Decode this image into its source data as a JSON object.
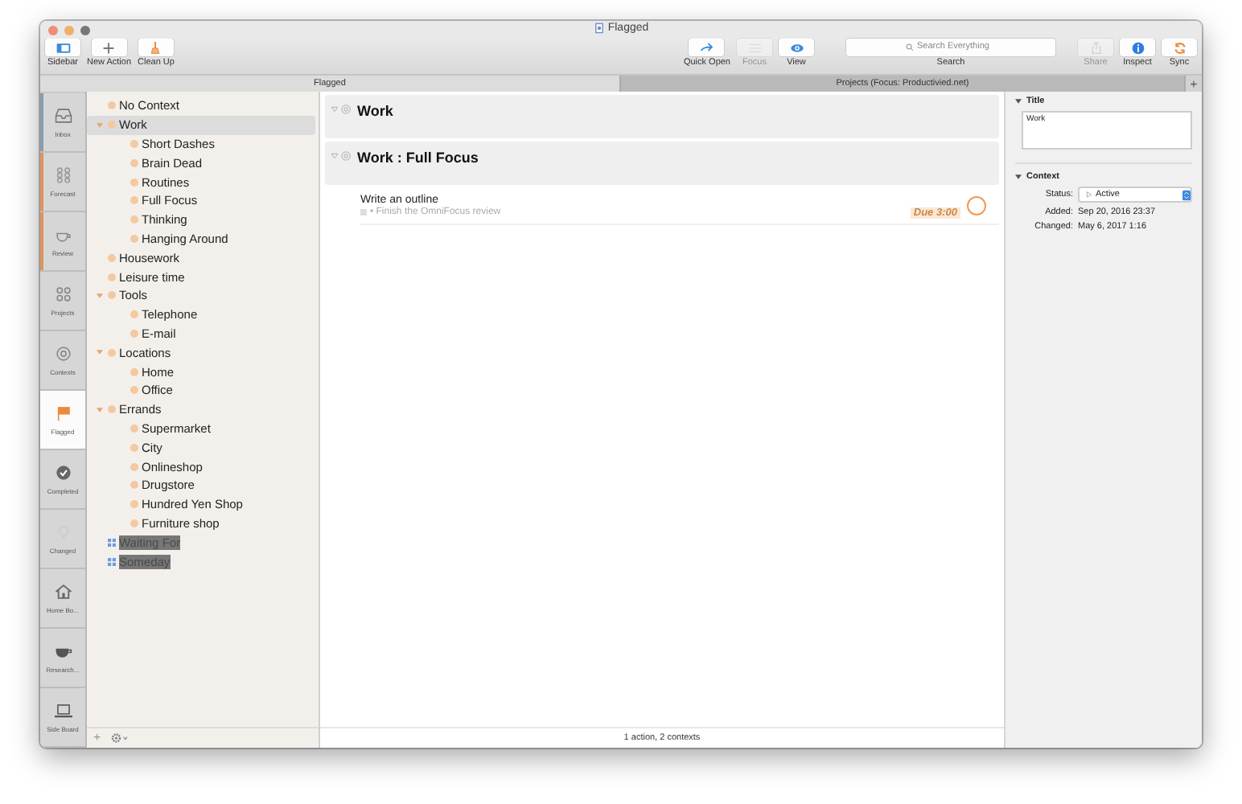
{
  "window": {
    "title": "Flagged"
  },
  "toolbar": {
    "left": [
      {
        "kind": "sidebar",
        "label": "Sidebar",
        "disabled": false
      },
      {
        "kind": "new",
        "label": "New Action",
        "disabled": false
      },
      {
        "kind": "cleanup",
        "label": "Clean Up",
        "disabled": false
      }
    ],
    "middle": [
      {
        "kind": "quickopen",
        "label": "Quick Open",
        "disabled": false
      },
      {
        "kind": "focus",
        "label": "Focus",
        "disabled": true
      },
      {
        "kind": "view",
        "label": "View",
        "disabled": false
      }
    ],
    "search": {
      "placeholder": "Search Everything",
      "label": "Search"
    },
    "right": [
      {
        "kind": "share",
        "label": "Share",
        "disabled": true
      },
      {
        "kind": "inspect",
        "label": "Inspect",
        "disabled": false
      },
      {
        "kind": "sync",
        "label": "Sync",
        "disabled": false
      }
    ]
  },
  "tabs": [
    {
      "label": "Flagged",
      "selected": true
    },
    {
      "label": "Projects (Focus: Productivied.net)",
      "selected": false
    }
  ],
  "perspectives": [
    {
      "kind": "inbox",
      "label": "Inbox",
      "selected": false,
      "color": "#8a9bb0"
    },
    {
      "kind": "forecast",
      "label": "Forecast",
      "selected": false,
      "color": "#e0935a"
    },
    {
      "kind": "review",
      "label": "Review",
      "selected": false,
      "color": "#e0935a"
    },
    {
      "kind": "projects",
      "label": "Projects",
      "selected": false
    },
    {
      "kind": "contexts",
      "label": "Contexts",
      "selected": false
    },
    {
      "kind": "flagged",
      "label": "Flagged",
      "selected": true
    },
    {
      "kind": "completed",
      "label": "Completed",
      "selected": false
    },
    {
      "kind": "changed",
      "label": "Changed",
      "selected": false
    },
    {
      "kind": "house",
      "label": "Home Bo...",
      "selected": false
    },
    {
      "kind": "cup",
      "label": "Research...",
      "selected": false
    },
    {
      "kind": "laptop",
      "label": "Side Board",
      "selected": false
    }
  ],
  "sidebar": {
    "items": [
      {
        "label": "No Context",
        "kind": "context",
        "selected": false
      },
      {
        "label": "Work",
        "kind": "context",
        "selected": true,
        "expanded": true,
        "children": [
          {
            "label": "Short Dashes",
            "kind": "context",
            "selected": false
          },
          {
            "label": "Brain Dead",
            "kind": "context",
            "selected": false
          },
          {
            "label": "Routines",
            "kind": "context",
            "selected": false
          },
          {
            "label": "Full Focus",
            "kind": "context",
            "selected": false
          },
          {
            "label": "Thinking",
            "kind": "context",
            "selected": false
          },
          {
            "label": "Hanging Around",
            "kind": "context",
            "selected": false
          }
        ]
      },
      {
        "label": "Housework",
        "kind": "context",
        "selected": false
      },
      {
        "label": "Leisure time",
        "kind": "context",
        "selected": false
      },
      {
        "label": "Tools",
        "kind": "context",
        "selected": false,
        "expanded": true,
        "children": [
          {
            "label": "Telephone",
            "kind": "context",
            "selected": false
          },
          {
            "label": "E-mail",
            "kind": "context",
            "selected": false
          }
        ]
      },
      {
        "label": "Locations",
        "kind": "context",
        "selected": false,
        "expanded": true,
        "children": [
          {
            "label": "Home",
            "kind": "context",
            "selected": false
          },
          {
            "label": "Office",
            "kind": "context",
            "selected": false
          }
        ]
      },
      {
        "label": "Errands",
        "kind": "context",
        "selected": false,
        "expanded": true,
        "children": [
          {
            "label": "Supermarket",
            "kind": "context",
            "selected": false
          },
          {
            "label": "City",
            "kind": "context",
            "selected": false
          },
          {
            "label": "Onlineshop",
            "kind": "context",
            "selected": false
          },
          {
            "label": "Drugstore",
            "kind": "context",
            "selected": false
          },
          {
            "label": "Hundred Yen Shop",
            "kind": "context",
            "selected": false
          },
          {
            "label": "Furniture shop",
            "kind": "context",
            "selected": false
          }
        ]
      },
      {
        "label": "Waiting For",
        "kind": "on-hold",
        "selected": false
      },
      {
        "label": "Someday",
        "kind": "on-hold",
        "selected": false
      }
    ]
  },
  "groups": [
    {
      "title": "Work",
      "expanded": true
    },
    {
      "title": "Work : Full Focus",
      "expanded": true,
      "actions": [
        {
          "title": "Write an outline",
          "project": "• Finish the OmniFocus review",
          "due": "Due 3:00",
          "flagged": true
        }
      ]
    }
  ],
  "status_bar": "1 action, 2 contexts",
  "inspector": {
    "title_section": {
      "heading": "Title",
      "value": "Work"
    },
    "context_section": {
      "heading": "Context",
      "status_label": "Status:",
      "status": "Active",
      "added_label": "Added:",
      "added": "Sep 20, 2016 23:37",
      "changed_label": "Changed:",
      "changed": "May 6, 2017 1:16"
    }
  },
  "sidebar_footer": {
    "add": "+"
  }
}
